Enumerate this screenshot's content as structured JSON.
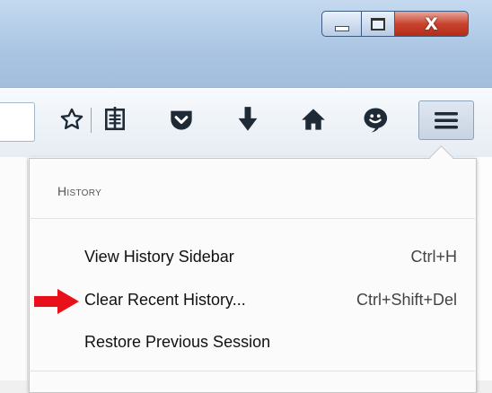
{
  "window": {
    "minimize_icon": "minimize-icon",
    "maximize_icon": "maximize-icon",
    "close_glyph": "X"
  },
  "toolbar": {
    "icons": [
      "star-bookmark-icon",
      "reading-list-icon",
      "pocket-icon",
      "download-icon",
      "home-icon",
      "smiley-feedback-icon"
    ],
    "menu_icon": "hamburger-menu-icon"
  },
  "history_panel": {
    "heading": "History",
    "items": [
      {
        "label": "View History Sidebar",
        "shortcut": "Ctrl+H"
      },
      {
        "label": "Clear Recent History...",
        "shortcut": "Ctrl+Shift+Del"
      },
      {
        "label": "Restore Previous Session",
        "shortcut": ""
      }
    ]
  },
  "annotation": {
    "color": "#e8111a",
    "icon": "red-arrow-icon"
  }
}
